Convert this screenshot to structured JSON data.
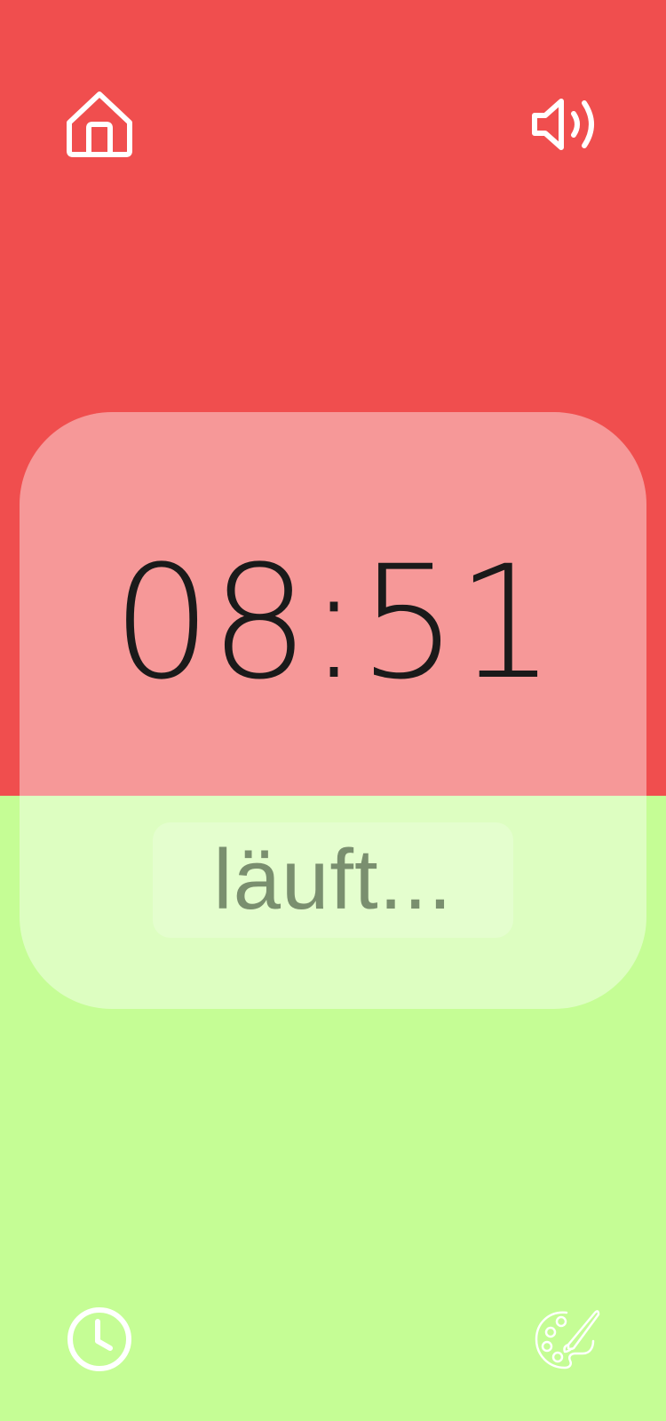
{
  "timer": {
    "time": "08:51",
    "status": "läuft..."
  },
  "icons": {
    "home": "home-icon",
    "sound": "speaker-volume-icon",
    "clock": "clock-icon",
    "palette": "palette-icon"
  },
  "colors": {
    "top_background": "#f04e4e",
    "bottom_background": "#c5fd95",
    "icon_color": "#ffffff",
    "time_color": "#1a1a1a",
    "status_color": "#7a8f6f"
  }
}
